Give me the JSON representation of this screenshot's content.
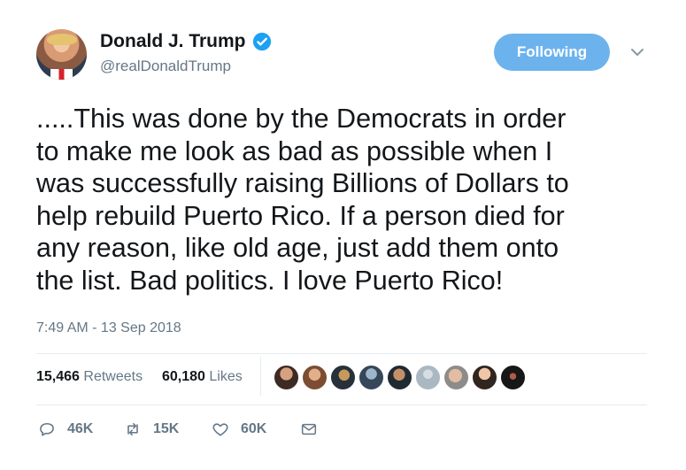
{
  "profile": {
    "display_name": "Donald J. Trump",
    "handle": "@realDonaldTrump",
    "avatar_icon": "profile-photo",
    "verified_icon": "verified-badge-icon",
    "verified_color": "#1da1f2"
  },
  "header": {
    "follow_label": "Following",
    "follow_color": "#6cb3ee",
    "menu_icon": "chevron-down-icon"
  },
  "tweet": {
    "text_lines": [
      ".....This was done by the Democrats in order",
      "to make me look as bad as possible when I",
      "was successfully raising Billions of Dollars to",
      "help rebuild Puerto Rico. If a person died for",
      "any reason, like old age, just add them onto",
      "the list. Bad politics. I love Puerto Rico!"
    ],
    "timestamp": "7:49 AM - 13 Sep 2018"
  },
  "stats": {
    "retweets_count": "15,466",
    "retweets_label": "Retweets",
    "likes_count": "60,180",
    "likes_label": "Likes",
    "liker_avatar_count": 9
  },
  "actions": {
    "reply_count": "46K",
    "retweet_count": "15K",
    "like_count": "60K",
    "reply_icon": "reply-icon",
    "retweet_icon": "retweet-icon",
    "like_icon": "heart-icon",
    "message_icon": "message-icon",
    "icon_color": "#657786"
  }
}
